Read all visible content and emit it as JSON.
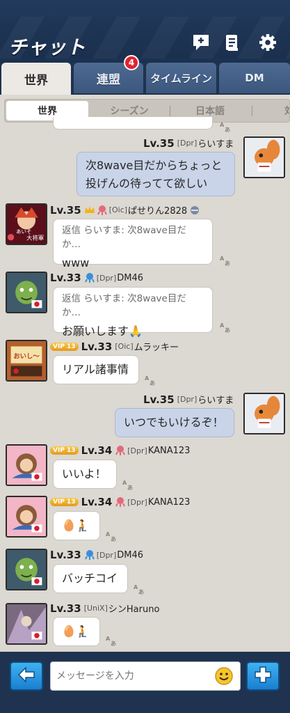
{
  "header": {
    "title": "チャット",
    "icons": [
      "new-chat-icon",
      "clipboard-icon",
      "gear-icon"
    ]
  },
  "tabs": [
    {
      "label": "世界",
      "active": true
    },
    {
      "label": "連盟",
      "badge": "4"
    },
    {
      "label": "タイムライン"
    },
    {
      "label": "DM"
    }
  ],
  "subtabs": [
    {
      "label": "世界",
      "active": true
    },
    {
      "label": "シーズン"
    },
    {
      "label": "日本語"
    },
    {
      "label": "対"
    }
  ],
  "messages": [
    {
      "side": "mine",
      "level": "Lv.35",
      "guild": "[Dpr]",
      "name": "らいすま",
      "text_line1": "次8wave目だからちょっと",
      "text_line2": "投げんの待ってて欲しい"
    },
    {
      "side": "other",
      "level": "Lv.35",
      "guild": "[Oic]",
      "name": "ぱせりん2828",
      "reply": "返信 らいすま: 次8wave目だか…",
      "text": "www"
    },
    {
      "side": "other",
      "level": "Lv.33",
      "guild": "[Dpr]",
      "name": "DM46",
      "reply": "返信 らいすま: 次8wave目だか…",
      "text": "お願いします🙏"
    },
    {
      "side": "other",
      "vip": "VIP 13",
      "level": "Lv.33",
      "guild": "[Oic]",
      "name": "ムラッキー",
      "text": "リアル諸事情"
    },
    {
      "side": "mine",
      "level": "Lv.35",
      "guild": "[Dpr]",
      "name": "らいすま",
      "text": "いつでもいけるぞ！"
    },
    {
      "side": "other",
      "vip": "VIP 13",
      "level": "Lv.34",
      "guild": "[Dpr]",
      "name": "KANA123",
      "text": "いいよ！"
    },
    {
      "side": "other",
      "vip": "VIP 13",
      "level": "Lv.34",
      "guild": "[Dpr]",
      "name": "KANA123",
      "text": "🥚🧎"
    },
    {
      "side": "other",
      "level": "Lv.33",
      "guild": "[Dpr]",
      "name": "DM46",
      "text": "バッチコイ"
    },
    {
      "side": "other",
      "level": "Lv.33",
      "guild": "[UniX]",
      "name": "シンHaruno",
      "text": "🥚🧎"
    }
  ],
  "avatar_labels": {
    "pasetrin_line1": "あいそ",
    "pasetrin_line2": "大将軍",
    "murakkii": "おいし〜"
  },
  "footer": {
    "placeholder": "メッセージを入力",
    "icons": [
      "back-arrow-icon",
      "smiley-icon",
      "plus-icon"
    ]
  },
  "colors": {
    "header_bg": "#1f3350",
    "chat_bg": "#dcd8d2",
    "mine_bubble": "#c9d4e8",
    "other_bubble": "#ffffff",
    "badge": "#e0242f",
    "accent_button": "#1a7fd0"
  }
}
